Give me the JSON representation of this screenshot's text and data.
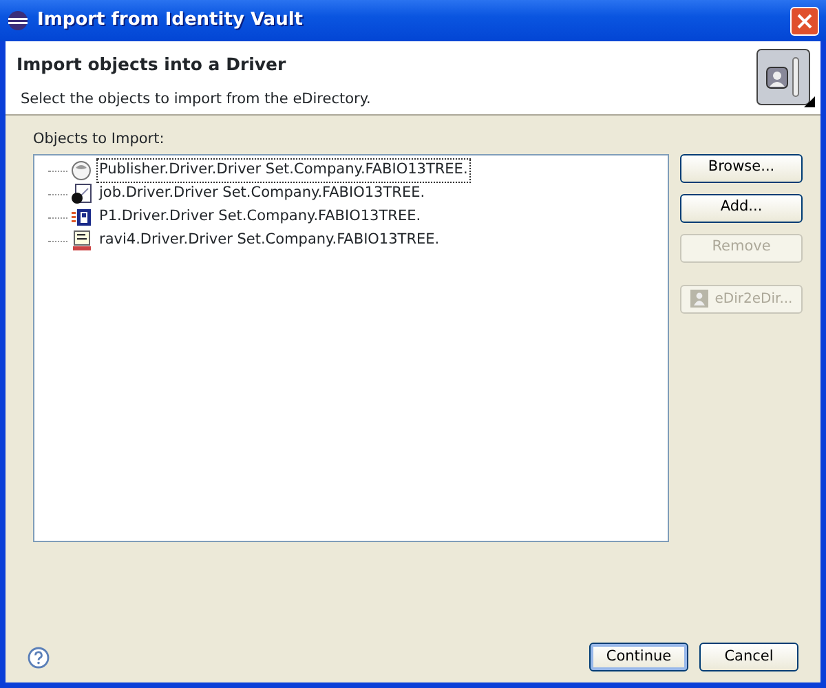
{
  "window": {
    "title": "Import from Identity Vault"
  },
  "header": {
    "title": "Import objects into a Driver",
    "description": "Select the objects to import from the eDirectory."
  },
  "objects": {
    "label": "Objects to Import:",
    "items": [
      {
        "kind": "publisher",
        "text": "Publisher.Driver.Driver Set.Company.FABIO13TREE.",
        "selected": true
      },
      {
        "kind": "job",
        "text": "job.Driver.Driver Set.Company.FABIO13TREE.",
        "selected": false
      },
      {
        "kind": "policy",
        "text": "P1.Driver.Driver Set.Company.FABIO13TREE.",
        "selected": false
      },
      {
        "kind": "ecma",
        "text": "ravi4.Driver.Driver Set.Company.FABIO13TREE.",
        "selected": false
      }
    ]
  },
  "side_buttons": [
    {
      "label": "Browse...",
      "disabled": false,
      "icon": false
    },
    {
      "label": "Add...",
      "disabled": false,
      "icon": false
    },
    {
      "label": "Remove",
      "disabled": true,
      "icon": false
    },
    {
      "label": "eDir2eDir...",
      "disabled": true,
      "icon": true
    }
  ],
  "footer_buttons": [
    {
      "label": "Continue",
      "default": true
    },
    {
      "label": "Cancel",
      "default": false
    }
  ]
}
